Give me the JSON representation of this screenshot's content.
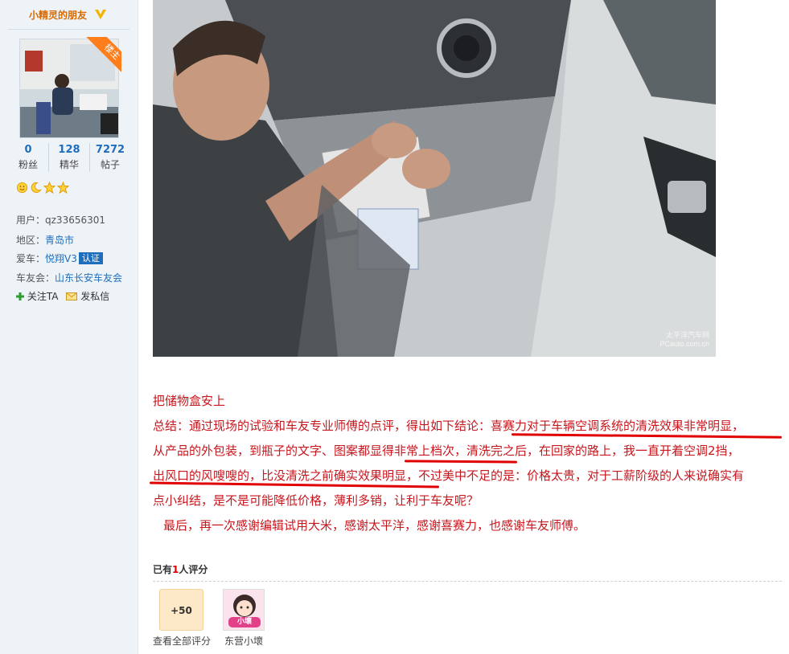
{
  "sidebar": {
    "username": "小精灵的朋友",
    "host_badge": "楼主",
    "stats": [
      {
        "num": "0",
        "label": "粉丝"
      },
      {
        "num": "128",
        "label": "精华"
      },
      {
        "num": "7272",
        "label": "帖子"
      }
    ],
    "level_icons": [
      "sun-icon",
      "moon-icon",
      "star-icon",
      "star-icon"
    ],
    "user_label": "用户：",
    "user_value": "qz33656301",
    "region_label": "地区：",
    "region_value": "青岛市",
    "car_label": "爱车：",
    "car_value": "悦翔V3",
    "car_badge": "认证",
    "club_label": "车友会：",
    "club_value": "山东长安车友会",
    "follow_label": "关注TA",
    "message_label": "发私信"
  },
  "photo": {
    "watermark": "太平洋汽车网 PCauto.com.cn"
  },
  "post": {
    "caption": "把储物盒安上",
    "line1": "总结：通过现场的试验和车友专业师傅的点评，得出如下结论：喜赛力对于车辆空调系统的清洗效果非常明显，",
    "line2": "从产品的外包装，到瓶子的文字、图案都显得非常上档次，清洗完之后，在回家的路上，我一直开着空调2挡，",
    "line3": "出风口的风嗖嗖的，比没清洗之前确实效果明显，不过美中不足的是：价格太贵，对于工薪阶级的人来说确实有",
    "line4": "点小纠结，是不是可能降低价格，薄利多销，让利于车友呢？",
    "line5": "最后，再一次感谢编辑试用大米，感谢太平洋，感谢喜赛力，也感谢车友师傅。"
  },
  "rating": {
    "prefix": "已有",
    "count": "1",
    "suffix": "人评分",
    "score": "+50",
    "view_all": "查看全部评分",
    "rater_name": "东营小壞",
    "rater_avatar_text": "小壞"
  },
  "colors": {
    "accent_red": "#c8161d",
    "underline": "#e00000",
    "link_blue": "#1e6ebd",
    "name_orange": "#d86a00"
  }
}
